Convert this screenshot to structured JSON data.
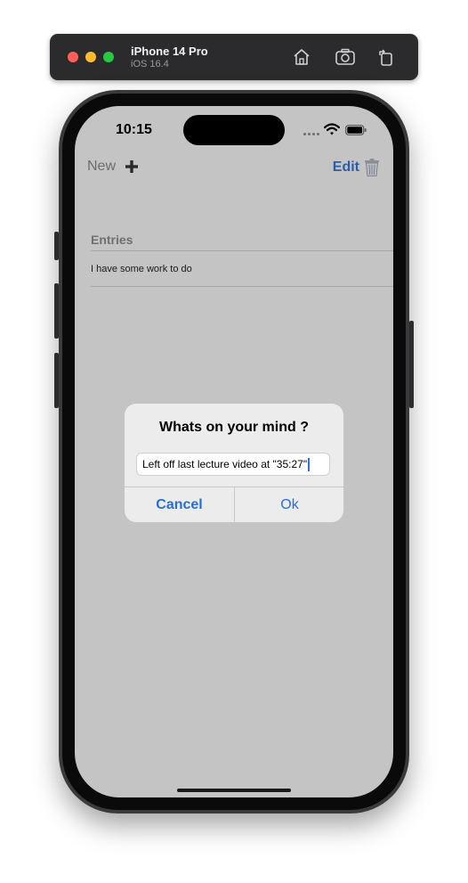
{
  "simulator": {
    "device_name": "iPhone 14 Pro",
    "os_version": "iOS 16.4",
    "icons": [
      "home-icon",
      "screenshot-icon",
      "rotate-icon"
    ]
  },
  "status_bar": {
    "time": "10:15",
    "icons": [
      "signal-icon",
      "wifi-icon",
      "battery-icon"
    ]
  },
  "nav": {
    "new_label": "New",
    "new_icon": "plus-icon",
    "edit_label": "Edit",
    "edit_icon": "trash-icon"
  },
  "list": {
    "section_header": "Entries",
    "items": [
      {
        "label": "I have some work to do"
      }
    ]
  },
  "alert": {
    "title": "Whats on your mind ?",
    "input_value": "Left off last lecture video at \"35:27\"",
    "cancel_label": "Cancel",
    "ok_label": "Ok"
  },
  "colors": {
    "screen_background": "#c4c4c4",
    "accent": "#2a6fd0",
    "edit_accent": "#2a5ea8",
    "alert_background": "#ececec",
    "toolbar_background": "#2b2b2d"
  }
}
